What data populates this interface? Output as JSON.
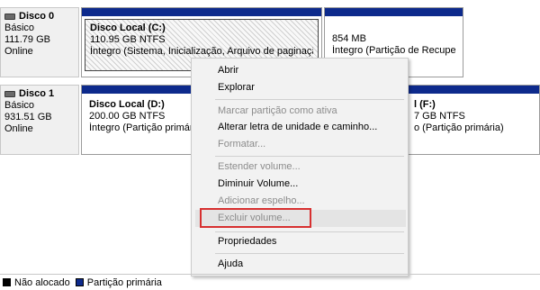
{
  "disks": [
    {
      "name": "Disco 0",
      "type": "Básico",
      "size": "111.79 GB",
      "status": "Online",
      "partitions": [
        {
          "name": "Disco Local  (C:)",
          "size": "110.95 GB NTFS",
          "status": "Íntegro (Sistema, Inicialização, Arquivo de paginação, At"
        },
        {
          "name": "",
          "size": "854 MB",
          "status": "Íntegro (Partição de Recuperaçã"
        }
      ]
    },
    {
      "name": "Disco 1",
      "type": "Básico",
      "size": "931.51 GB",
      "status": "Online",
      "partitions": [
        {
          "name": "Disco Local  (D:)",
          "size": "200.00 GB NTFS",
          "status": "Íntegro (Partição primária"
        },
        {
          "name": "l  (F:)",
          "size": "7 GB NTFS",
          "status": "o (Partição primária)"
        }
      ]
    }
  ],
  "context_menu": {
    "items": [
      {
        "label": "Abrir",
        "enabled": true
      },
      {
        "label": "Explorar",
        "enabled": true
      },
      {
        "label": "Marcar partição como ativa",
        "enabled": false
      },
      {
        "label": "Alterar letra de unidade e caminho...",
        "enabled": true
      },
      {
        "label": "Formatar...",
        "enabled": false
      },
      {
        "label": "Estender volume...",
        "enabled": false
      },
      {
        "label": "Diminuir Volume...",
        "enabled": true
      },
      {
        "label": "Adicionar espelho...",
        "enabled": false
      },
      {
        "label": "Excluir volume...",
        "enabled": false,
        "highlighted": true
      },
      {
        "label": "Propriedades",
        "enabled": true
      },
      {
        "label": "Ajuda",
        "enabled": true
      }
    ]
  },
  "legend": {
    "unallocated": "Não alocado",
    "primary": "Partição primária"
  },
  "colors": {
    "primary_partition": "#0d2a8c",
    "unallocated": "#000000",
    "highlight_border": "#d73030"
  }
}
